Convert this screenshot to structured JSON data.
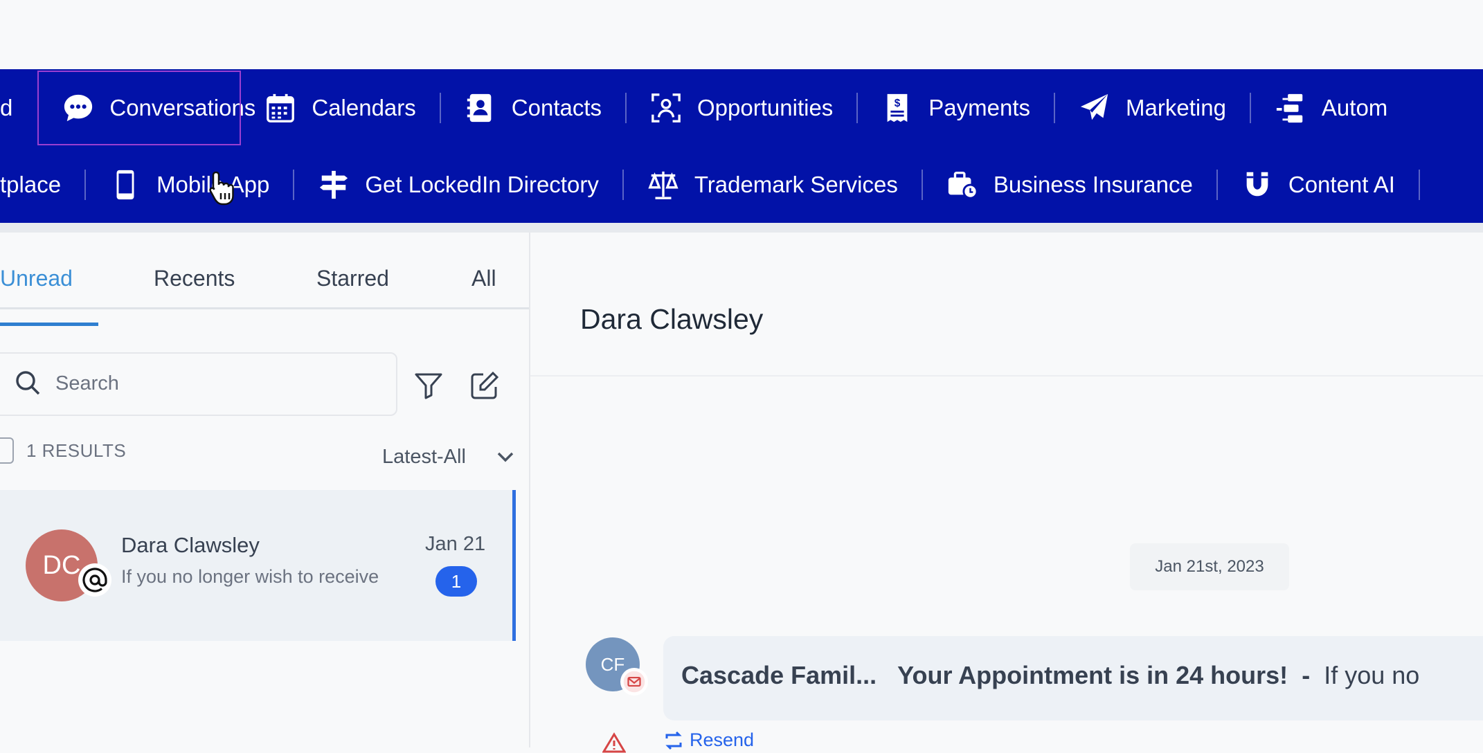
{
  "nav": {
    "row1": [
      {
        "label": "d",
        "icon": "partial-icon"
      },
      {
        "label": "Conversations",
        "icon": "chat-bubble-icon"
      },
      {
        "label": "Calendars",
        "icon": "calendar-icon"
      },
      {
        "label": "Contacts",
        "icon": "contact-book-icon"
      },
      {
        "label": "Opportunities",
        "icon": "target-user-icon"
      },
      {
        "label": "Payments",
        "icon": "receipt-dollar-icon"
      },
      {
        "label": "Marketing",
        "icon": "paper-plane-icon"
      },
      {
        "label": "Autom",
        "icon": "automation-icon"
      }
    ],
    "row2": [
      {
        "label": "tplace",
        "icon": ""
      },
      {
        "label": "Mobile App",
        "icon": "mobile-phone-icon"
      },
      {
        "label": "Get LockedIn Directory",
        "icon": "signpost-icon"
      },
      {
        "label": "Trademark Services",
        "icon": "scales-icon"
      },
      {
        "label": "Business Insurance",
        "icon": "briefcase-clock-icon"
      },
      {
        "label": "Content AI",
        "icon": "magnet-icon"
      }
    ],
    "colors": {
      "background": "#0212a8",
      "active_outline": "#9b3fd0"
    }
  },
  "conversations": {
    "tabs": [
      "Unread",
      "Recents",
      "Starred",
      "All"
    ],
    "active_tab": "Unread",
    "search_placeholder": "Search",
    "results": "1 RESULTS",
    "sort": "Latest-All",
    "items": [
      {
        "initials": "DC",
        "name": "Dara Clawsley",
        "snippet": "If you no longer wish to receive",
        "date": "Jan 21",
        "unread": "1"
      }
    ]
  },
  "chat": {
    "title": "Dara Clawsley",
    "date_divider": "Jan 21st, 2023",
    "message": {
      "initials": "CF",
      "sender": "Cascade Famil...",
      "subject": "Your Appointment is in 24 hours!",
      "separator": "-",
      "preview": "If you no"
    },
    "resend_label": "Resend"
  }
}
